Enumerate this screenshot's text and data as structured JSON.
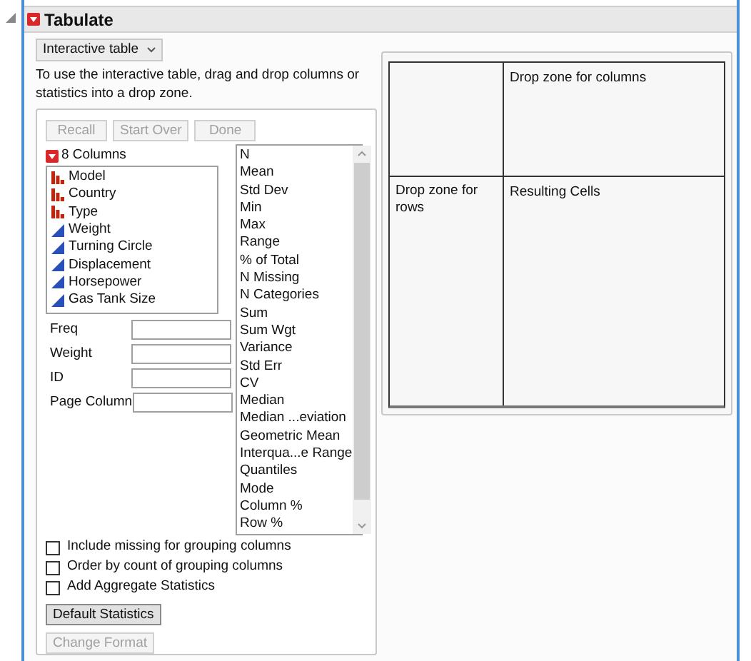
{
  "report": {
    "title": "Tabulate",
    "expanded": true
  },
  "mode_dropdown": {
    "value": "Interactive table"
  },
  "instructions": "To use the interactive table, drag and drop columns or statistics into a drop zone.",
  "buttons": [
    {
      "label": "Recall",
      "disabled": true
    },
    {
      "label": "Start Over",
      "disabled": true
    },
    {
      "label": "Done",
      "disabled": true
    }
  ],
  "columns_header": "8 Columns",
  "columns": [
    {
      "name": "Model",
      "kind": "nominal"
    },
    {
      "name": "Country",
      "kind": "nominal"
    },
    {
      "name": "Type",
      "kind": "nominal"
    },
    {
      "name": "Weight",
      "kind": "continuous"
    },
    {
      "name": "Turning Circle",
      "kind": "continuous"
    },
    {
      "name": "Displacement",
      "kind": "continuous"
    },
    {
      "name": "Horsepower",
      "kind": "continuous"
    },
    {
      "name": "Gas Tank Size",
      "kind": "continuous"
    }
  ],
  "role_fields": [
    {
      "label": "Freq"
    },
    {
      "label": "Weight"
    },
    {
      "label": "ID"
    },
    {
      "label": "Page Column"
    }
  ],
  "statistics": [
    "N",
    "Mean",
    "Std Dev",
    "Min",
    "Max",
    "Range",
    "% of Total",
    "N Missing",
    "N Categories",
    "Sum",
    "Sum Wgt",
    "Variance",
    "Std Err",
    "CV",
    "Median",
    "Median ...eviation",
    "Geometric Mean",
    "Interqua...e Range",
    "Quantiles",
    "Mode",
    "Column %",
    "Row %"
  ],
  "options": [
    {
      "label": "Include missing for grouping columns",
      "checked": false
    },
    {
      "label": "Order by count of grouping columns",
      "checked": false
    },
    {
      "label": "Add Aggregate Statistics",
      "checked": false
    }
  ],
  "bottom_buttons": [
    {
      "label": "Default Statistics",
      "disabled": false
    },
    {
      "label": "Change Format",
      "disabled": true
    }
  ],
  "table": {
    "column_zone": "Drop zone for columns",
    "row_zone": "Drop zone for rows",
    "cells": "Resulting Cells"
  }
}
